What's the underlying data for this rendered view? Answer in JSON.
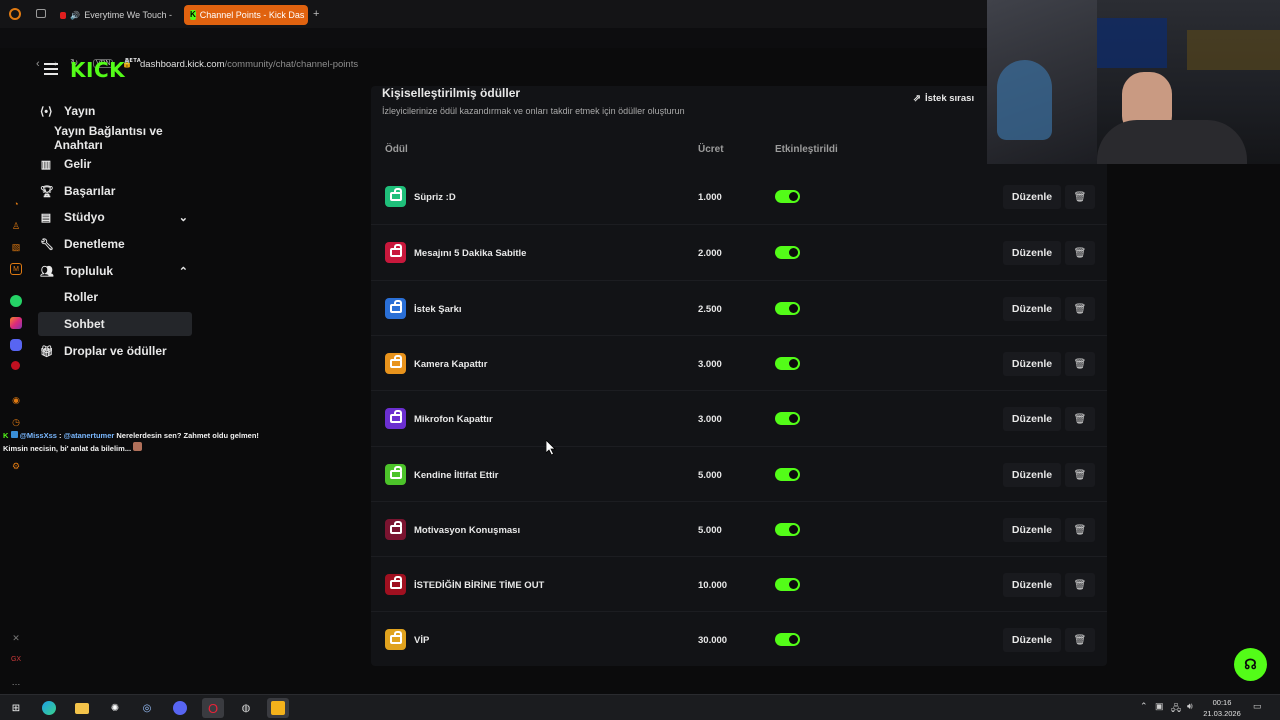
{
  "browser": {
    "tabs": [
      {
        "label": "Everytime We Touch -",
        "active": false
      },
      {
        "label": "Channel Points - Kick Das",
        "active": true
      }
    ],
    "new_tab": "+",
    "vpn": "VPN",
    "url_domain": "dashboard.kick.com",
    "url_path": "/community/chat/channel-points"
  },
  "brand": {
    "logo": "KICK",
    "logo_badge": "BETA",
    "accent": "#53fc18"
  },
  "nav": {
    "yayin": "Yayın",
    "yayin_baglanti": "Yayın Bağlantısı ve Anahtarı",
    "gelir": "Gelir",
    "basarilar": "Başarılar",
    "studyo": "Stüdyo",
    "denetleme": "Denetleme",
    "topluluk": "Topluluk",
    "roller": "Roller",
    "sohbet": "Sohbet",
    "droplar": "Droplar ve ödüller"
  },
  "chat": {
    "user": "@MissXss",
    "mention": "@atanertumer",
    "message": "Nerelerdesin sen? Zahmet oldu gelmen! Kimsin necisin, bi' anlat da bilelim..."
  },
  "panel": {
    "title": "Kişiselleştirilmiş ödüller",
    "subtitle": "İzleyicilerinize ödül kazandırmak ve onları takdir etmek için ödüller oluşturun",
    "queue_button": "İstek sırası",
    "columns": {
      "reward": "Ödül",
      "cost": "Ücret",
      "enabled": "Etkinleştirildi"
    },
    "edit_label": "Düzenle",
    "rewards": [
      {
        "name": "Süpriz :D",
        "cost": "1.000",
        "color": "#1fbf7a",
        "enabled": true
      },
      {
        "name": "Mesajını 5 Dakika Sabitle",
        "cost": "2.000",
        "color": "#c8183c",
        "enabled": true
      },
      {
        "name": "İstek Şarkı",
        "cost": "2.500",
        "color": "#2a6fd6",
        "enabled": true
      },
      {
        "name": "Kamera Kapattır",
        "cost": "3.000",
        "color": "#e8931c",
        "enabled": true
      },
      {
        "name": "Mikrofon Kapattır",
        "cost": "3.000",
        "color": "#6b2fd0",
        "enabled": true
      },
      {
        "name": "Kendine İltifat Ettir",
        "cost": "5.000",
        "color": "#4cc32a",
        "enabled": true
      },
      {
        "name": "Motivasyon Konuşması",
        "cost": "5.000",
        "color": "#7a1430",
        "enabled": true
      },
      {
        "name": "İSTEDİĞİN BİRİNE TİME OUT",
        "cost": "10.000",
        "color": "#a01020",
        "enabled": true
      },
      {
        "name": "VİP",
        "cost": "30.000",
        "color": "#e0a21e",
        "enabled": true
      }
    ]
  },
  "taskbar": {
    "time": "00:16",
    "date": "21.03.2026"
  }
}
